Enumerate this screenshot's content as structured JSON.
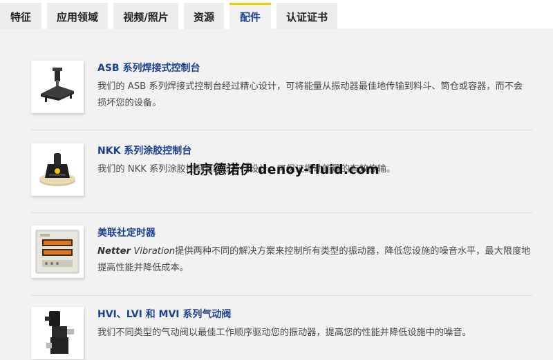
{
  "tabs": [
    {
      "label": "特征"
    },
    {
      "label": "应用领域"
    },
    {
      "label": "视频/照片"
    },
    {
      "label": "资源"
    },
    {
      "label": "配件"
    },
    {
      "label": "认证证书"
    }
  ],
  "active_tab": "配件",
  "accent_color": "#f4d000",
  "link_color": "#1d3f8f",
  "items": [
    {
      "title": "ASB 系列焊接式控制台",
      "description": "我们的 ASB 系列焊接式控制台经过精心设计，可将能量从振动器最佳地传输到料斗、筒仓或容器，而不会损坏您的设备。",
      "icon": "welded-console-image"
    },
    {
      "title": "NKK 系列涂胶控制台",
      "description": "我们的 NKK 系列涂胶控制台经过专门设计，可保证振动能量的有效传输。",
      "icon": "glued-console-image"
    },
    {
      "title": "美联社定时器",
      "description_brand": "Netter",
      "description_brand2": " Vibration",
      "description": "提供两种不同的解决方案来控制所有类型的振动器，降低您设施的噪音水平，最大限度地提高性能并降低成本。",
      "icon": "timer-controller-image"
    },
    {
      "title": "HVI、LVI 和 MVI 系列气动阀",
      "description": "我们不同类型的气动阀以最佳工作顺序驱动您的振动器，提高您的性能并降低设施中的噪音。",
      "icon": "pneumatic-valve-image"
    }
  ],
  "watermark": "北京德诺伊 denoy-fluid.com"
}
